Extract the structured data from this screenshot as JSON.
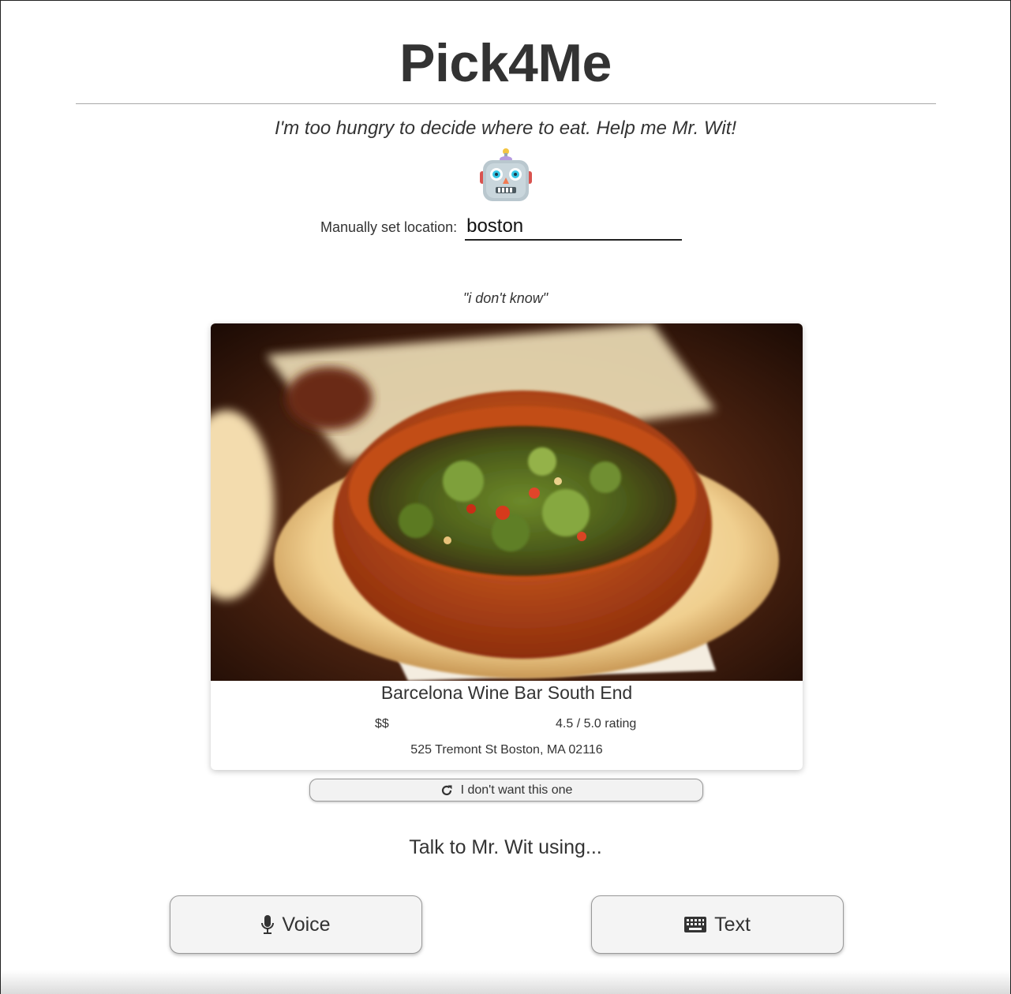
{
  "header": {
    "title": "Pick4Me",
    "tagline": "I'm too hungry to decide where to eat. Help me Mr. Wit!",
    "mascot_icon": "robot-icon"
  },
  "location": {
    "label": "Manually set location:",
    "value": "boston"
  },
  "query": {
    "text": "\"i don't know\""
  },
  "result": {
    "name": "Barcelona Wine Bar South End",
    "price": "$$",
    "rating": "4.5 / 5.0 rating",
    "address": "525 Tremont St Boston, MA 02116",
    "reject_label": "I don't want this one",
    "reject_icon": "refresh-icon"
  },
  "talk": {
    "heading": "Talk to Mr. Wit using...",
    "voice_label": "Voice",
    "voice_icon": "microphone-icon",
    "text_label": "Text",
    "text_icon": "keyboard-icon"
  },
  "colors": {
    "text": "#333333",
    "button_bg": "#f4f4f4",
    "divider": "#a8a8a8"
  }
}
